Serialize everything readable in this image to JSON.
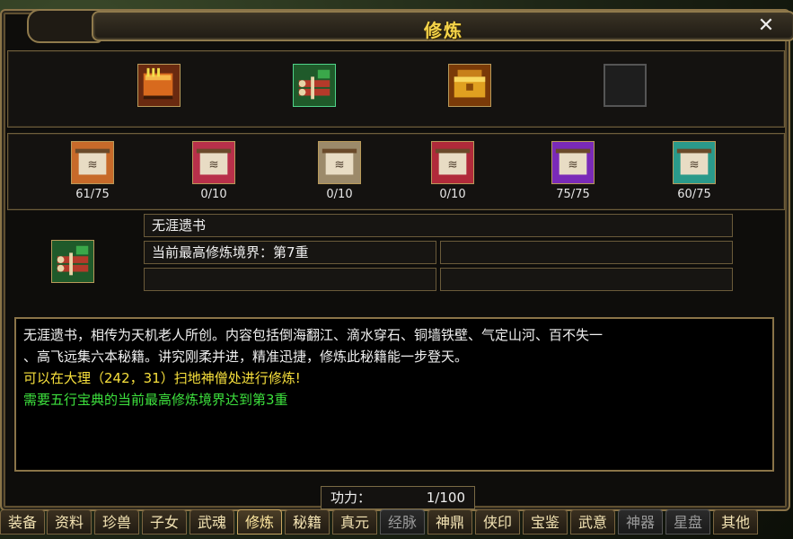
{
  "window": {
    "title": "修炼",
    "help": "?",
    "close": "✕"
  },
  "books": [
    {
      "icon": "orange-book-icon",
      "color": "#c8651a"
    },
    {
      "icon": "green-scroll-bundle-icon",
      "color": "#2f8f3a"
    },
    {
      "icon": "golden-chest-icon",
      "color": "#d99a1a"
    },
    {
      "icon": "empty-slot-icon",
      "color": "#222222"
    }
  ],
  "scrolls": [
    {
      "icon": "orange-scroll-icon",
      "color": "#c76a2a",
      "count": "61/75"
    },
    {
      "icon": "red-scroll-icon",
      "color": "#b8304a",
      "count": "0/10"
    },
    {
      "icon": "tan-scroll-icon",
      "color": "#9c8a6a",
      "count": "0/10"
    },
    {
      "icon": "crimson-scroll-icon",
      "color": "#b02a3a",
      "count": "0/10"
    },
    {
      "icon": "purple-scroll-icon",
      "color": "#7a2ab8",
      "count": "75/75"
    },
    {
      "icon": "teal-scroll-icon",
      "color": "#2a9a8a",
      "count": "60/75"
    }
  ],
  "selected": {
    "icon": "green-scroll-bundle-icon",
    "name": "无涯遗书",
    "realm": "当前最高修炼境界：第7重"
  },
  "description": {
    "line1": "无涯遗书，相传为天机老人所创。内容包括倒海翻江、滴水穿石、铜墙铁壁、气定山河、百不失一",
    "line2": "、高飞远集六本秘籍。讲究刚柔并进，精准迅捷，修炼此秘籍能一步登天。",
    "line3": "可以在大理（242，31）扫地神僧处进行修炼!",
    "line4": "需要五行宝典的当前最高修炼境界达到第3重"
  },
  "power": {
    "label": "功力：",
    "value": "1/100"
  },
  "tabs": [
    "装备",
    "资料",
    "珍兽",
    "子女",
    "武魂",
    "修炼",
    "秘籍",
    "真元",
    "经脉",
    "神鼎",
    "侠印",
    "宝鉴",
    "武意",
    "神器",
    "星盘",
    "其他"
  ],
  "active_tab": "修炼",
  "disabled_tabs": [
    "经脉",
    "神器",
    "星盘"
  ]
}
